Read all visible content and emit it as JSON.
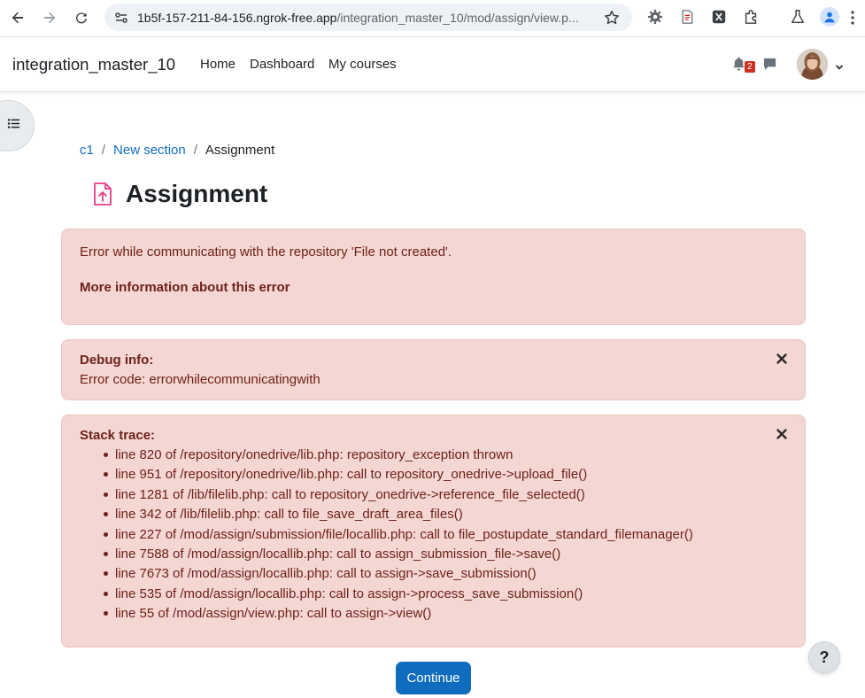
{
  "browser": {
    "url_host": "1b5f-157-211-84-156.ngrok-free.app",
    "url_path": "/integration_master_10/mod/assign/view.p..."
  },
  "navbar": {
    "site_name": "integration_master_10",
    "links": [
      "Home",
      "Dashboard",
      "My courses"
    ],
    "notification_count": "2"
  },
  "breadcrumb": {
    "items": [
      "c1",
      "New section"
    ],
    "current": "Assignment"
  },
  "page": {
    "title": "Assignment",
    "icon": "assignment-upload-icon",
    "icon_color": "#ea3b86"
  },
  "error": {
    "message": "Error while communicating with the repository 'File not created'.",
    "more_info_link": "More information about this error"
  },
  "debug": {
    "heading": "Debug info:",
    "code_text": "Error code: errorwhilecommunicatingwith"
  },
  "stack": {
    "heading": "Stack trace:",
    "lines": [
      "line 820 of /repository/onedrive/lib.php: repository_exception thrown",
      "line 951 of /repository/onedrive/lib.php: call to repository_onedrive->upload_file()",
      "line 1281 of /lib/filelib.php: call to repository_onedrive->reference_file_selected()",
      "line 342 of /lib/filelib.php: call to file_save_draft_area_files()",
      "line 227 of /mod/assign/submission/file/locallib.php: call to file_postupdate_standard_filemanager()",
      "line 7588 of /mod/assign/locallib.php: call to assign_submission_file->save()",
      "line 7673 of /mod/assign/locallib.php: call to assign->save_submission()",
      "line 535 of /mod/assign/locallib.php: call to assign->process_save_submission()",
      "line 55 of /mod/assign/view.php: call to assign->view()"
    ]
  },
  "actions": {
    "continue_label": "Continue",
    "help_label": "?"
  },
  "colors": {
    "primary": "#0f6cbf",
    "alert_bg": "#f4d6d2",
    "alert_text": "#6e211a",
    "badge": "#ca3120"
  }
}
